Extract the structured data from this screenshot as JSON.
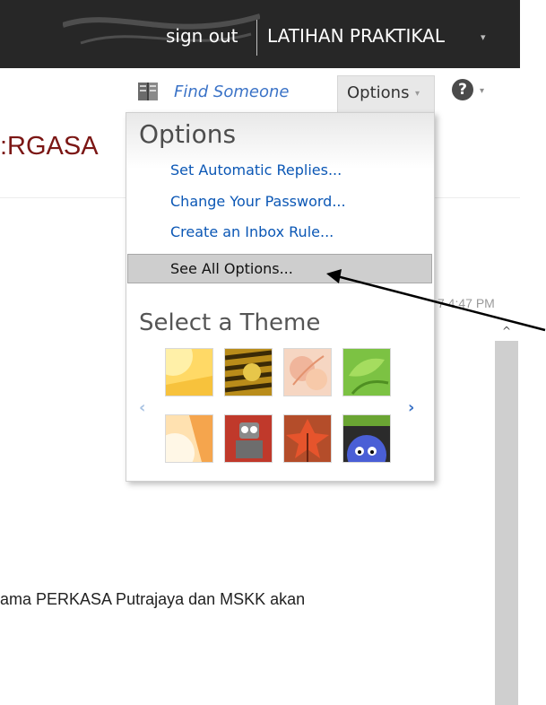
{
  "header": {
    "sign_out": "sign out",
    "user_name": "LATIHAN PRAKTIKAL",
    "user_caret": "▾"
  },
  "toolbar": {
    "find_someone": "Find Someone",
    "options_label": "Options",
    "options_caret": "▾",
    "help_symbol": "?",
    "help_caret": "▾"
  },
  "background": {
    "title_fragment": ":RGASA",
    "time_fragment": "7 4:47 PM",
    "body_fragment": "ama PERKASA Putrajaya dan MSKK akan"
  },
  "options_menu": {
    "title": "Options",
    "items": [
      "Set Automatic Replies...",
      "Change Your Password...",
      "Create an Inbox Rule..."
    ],
    "see_all": "See All Options...",
    "theme_title": "Select a Theme",
    "prev_arrow": "‹",
    "next_arrow": "›",
    "themes": [
      "sunshine-theme",
      "tiger-theme",
      "floral-theme",
      "leaves-theme",
      "sunset-theme",
      "robot-theme",
      "autumn-theme",
      "monster-theme"
    ]
  },
  "scrollbar": {
    "up_arrow": "^"
  },
  "colors": {
    "topbar": "#272727",
    "link": "#0b57b5",
    "title_red": "#7b1614",
    "highlight": "#cecece"
  }
}
